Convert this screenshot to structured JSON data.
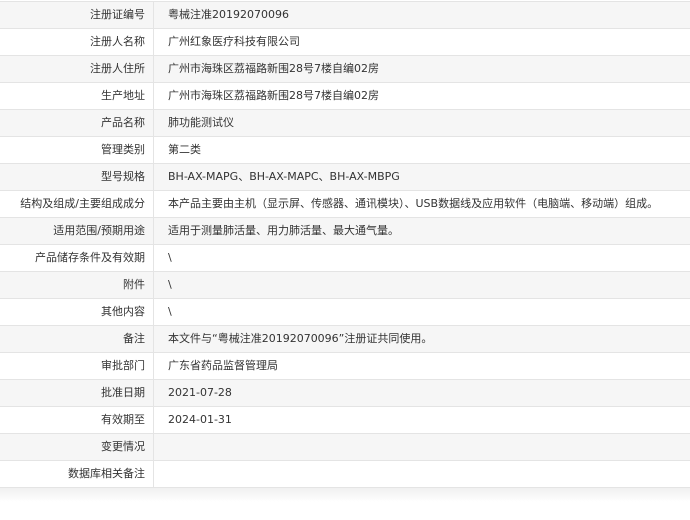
{
  "rows": [
    {
      "label": "注册证编号",
      "value": "粤械注准20192070096"
    },
    {
      "label": "注册人名称",
      "value": "广州红象医疗科技有限公司"
    },
    {
      "label": "注册人住所",
      "value": "广州市海珠区荔福路新围28号7楼自编02房"
    },
    {
      "label": "生产地址",
      "value": "广州市海珠区荔福路新围28号7楼自编02房"
    },
    {
      "label": "产品名称",
      "value": "肺功能测试仪"
    },
    {
      "label": "管理类别",
      "value": "第二类"
    },
    {
      "label": "型号规格",
      "value": "BH-AX-MAPG、BH-AX-MAPC、BH-AX-MBPG"
    },
    {
      "label": "结构及组成/主要组成成分",
      "value": "本产品主要由主机（显示屏、传感器、通讯模块）、USB数据线及应用软件（电脑端、移动端）组成。"
    },
    {
      "label": "适用范围/预期用途",
      "value": "适用于测量肺活量、用力肺活量、最大通气量。"
    },
    {
      "label": "产品储存条件及有效期",
      "value": "\\"
    },
    {
      "label": "附件",
      "value": "\\"
    },
    {
      "label": "其他内容",
      "value": "\\"
    },
    {
      "label": "备注",
      "value": "本文件与“粤械注准20192070096”注册证共同使用。"
    },
    {
      "label": "审批部门",
      "value": "广东省药品监督管理局"
    },
    {
      "label": "批准日期",
      "value": "2021-07-28"
    },
    {
      "label": "有效期至",
      "value": "2024-01-31"
    },
    {
      "label": "变更情况",
      "value": ""
    },
    {
      "label": "数据库相关备注",
      "value": ""
    }
  ]
}
